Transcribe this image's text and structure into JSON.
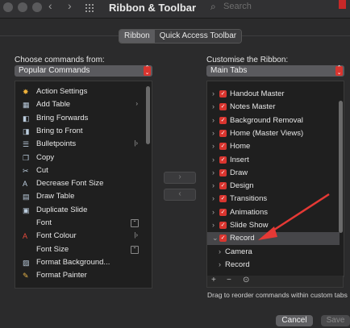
{
  "window": {
    "title": "Ribbon & Toolbar",
    "nav_back": "‹",
    "nav_forward": "›",
    "search_placeholder": "Search"
  },
  "tabs": [
    {
      "label": "Ribbon",
      "selected": true
    },
    {
      "label": "Quick Access Toolbar",
      "selected": false
    }
  ],
  "left": {
    "label": "Choose commands from:",
    "dropdown_value": "Popular Commands",
    "commands": [
      {
        "label": "Action Settings",
        "icon": "star-icon",
        "right": ""
      },
      {
        "label": "Add Table",
        "icon": "table-icon",
        "right": "›"
      },
      {
        "label": "Bring Forwards",
        "icon": "bring-forward-icon",
        "right": ""
      },
      {
        "label": "Bring to Front",
        "icon": "bring-front-icon",
        "right": ""
      },
      {
        "label": "Bulletpoints",
        "icon": "bullets-icon",
        "right": "|›"
      },
      {
        "label": "Copy",
        "icon": "copy-icon",
        "right": ""
      },
      {
        "label": "Cut",
        "icon": "scissors-icon",
        "right": ""
      },
      {
        "label": "Decrease Font Size",
        "icon": "decrease-font-icon",
        "right": ""
      },
      {
        "label": "Draw Table",
        "icon": "draw-table-icon",
        "right": ""
      },
      {
        "label": "Duplicate Slide",
        "icon": "duplicate-slide-icon",
        "right": ""
      },
      {
        "label": "Font",
        "icon": "",
        "right": "box"
      },
      {
        "label": "Font Colour",
        "icon": "font-colour-icon",
        "right": "|›"
      },
      {
        "label": "Font Size",
        "icon": "",
        "right": "box"
      },
      {
        "label": "Format Background...",
        "icon": "format-background-icon",
        "right": ""
      },
      {
        "label": "Format Painter",
        "icon": "format-painter-icon",
        "right": ""
      }
    ]
  },
  "right": {
    "label": "Customise the Ribbon:",
    "dropdown_value": "Main Tabs",
    "tabs": [
      {
        "label": "Handout Master",
        "checked": true,
        "expanded": false
      },
      {
        "label": "Notes Master",
        "checked": true,
        "expanded": false
      },
      {
        "label": "Background Removal",
        "checked": true,
        "expanded": false
      },
      {
        "label": "Home (Master Views)",
        "checked": true,
        "expanded": false
      },
      {
        "label": "Home",
        "checked": true,
        "expanded": false
      },
      {
        "label": "Insert",
        "checked": true,
        "expanded": false
      },
      {
        "label": "Draw",
        "checked": true,
        "expanded": false
      },
      {
        "label": "Design",
        "checked": true,
        "expanded": false
      },
      {
        "label": "Transitions",
        "checked": true,
        "expanded": false
      },
      {
        "label": "Animations",
        "checked": true,
        "expanded": false
      },
      {
        "label": "Slide Show",
        "checked": true,
        "expanded": false
      },
      {
        "label": "Record",
        "checked": true,
        "expanded": true,
        "selected": true
      }
    ],
    "subgroups": [
      "Camera",
      "Record"
    ],
    "toolbar": {
      "add": "+",
      "remove": "−",
      "more": "⊙"
    },
    "hint": "Drag to reorder commands within custom tabs"
  },
  "move": {
    "add": "›",
    "remove": "‹"
  },
  "buttons": {
    "cancel": "Cancel",
    "save": "Save"
  },
  "colors": {
    "accent_red": "#d9352f",
    "annotation_arrow": "#e53935"
  }
}
